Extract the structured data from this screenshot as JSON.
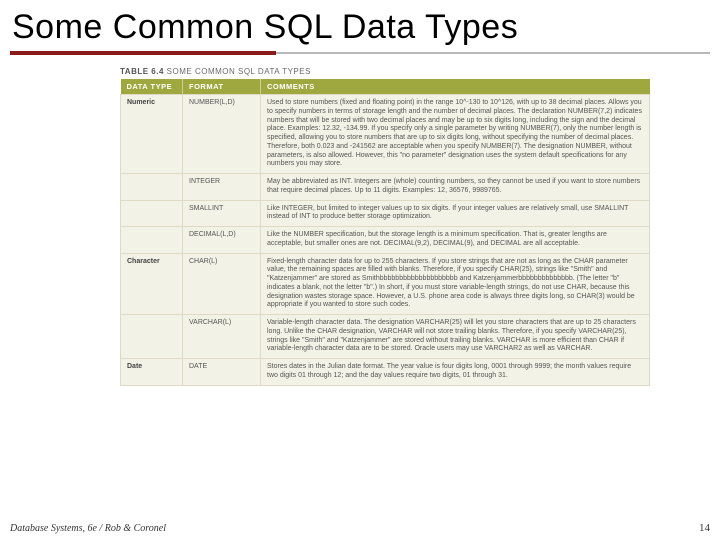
{
  "title": "Some Common SQL Data Types",
  "caption_prefix": "TABLE 6.4",
  "caption_text": "Some Common SQL Data Types",
  "headers": [
    "Data Type",
    "Format",
    "Comments"
  ],
  "rows": [
    {
      "dt": "Numeric",
      "fmt": "NUMBER(L,D)",
      "cmt": "Used to store numbers (fixed and floating point) in the range 10^-130 to 10^126, with up to 38 decimal places. Allows you to specify numbers in terms of storage length and the number of decimal places. The declaration NUMBER(7,2) indicates numbers that will be stored with two decimal places and may be up to six digits long, including the sign and the decimal place. Examples: 12.32, -134.99. If you specify only a single parameter by writing NUMBER(7), only the number length is specified, allowing you to store numbers that are up to six digits long, without specifying the number of decimal places. Therefore, both 0.023 and -241562 are acceptable when you specify NUMBER(7). The designation NUMBER, without parameters, is also allowed. However, this \"no parameter\" designation uses the system default specifications for any numbers you may store."
    },
    {
      "dt": "",
      "fmt": "INTEGER",
      "cmt": "May be abbreviated as INT. Integers are (whole) counting numbers, so they cannot be used if you want to store numbers that require decimal places. Up to 11 digits. Examples: 12, 36576, 9989765."
    },
    {
      "dt": "",
      "fmt": "SMALLINT",
      "cmt": "Like INTEGER, but limited to integer values up to six digits. If your integer values are relatively small, use SMALLINT instead of INT to produce better storage optimization."
    },
    {
      "dt": "",
      "fmt": "DECIMAL(L,D)",
      "cmt": "Like the NUMBER specification, but the storage length is a minimum specification. That is, greater lengths are acceptable, but smaller ones are not. DECIMAL(9,2), DECIMAL(9), and DECIMAL are all acceptable."
    },
    {
      "dt": "Character",
      "fmt": "CHAR(L)",
      "cmt": "Fixed-length character data for up to 255 characters. If you store strings that are not as long as the CHAR parameter value, the remaining spaces are filled with blanks. Therefore, if you specify CHAR(25), strings like \"Smith\" and \"Katzenjammer\" are stored as Smithbbbbbbbbbbbbbbbbbbbb and Katzenjammerbbbbbbbbbbbbbb. (The letter \"b\" indicates a blank, not the letter \"b\".) In short, if you must store variable-length strings, do not use CHAR, because this designation wastes storage space. However, a U.S. phone area code is always three digits long, so CHAR(3) would be appropriate if you wanted to store such codes."
    },
    {
      "dt": "",
      "fmt": "VARCHAR(L)",
      "cmt": "Variable-length character data. The designation VARCHAR(25) will let you store characters that are up to 25 characters long. Unlike the CHAR designation, VARCHAR will not store trailing blanks. Therefore, if you specify VARCHAR(25), strings like \"Smith\" and \"Katzenjammer\" are stored without trailing blanks. VARCHAR is more efficient than CHAR if variable-length character data are to be stored. Oracle users may use VARCHAR2 as well as VARCHAR."
    },
    {
      "dt": "Date",
      "fmt": "DATE",
      "cmt": "Stores dates in the Julian date format. The year value is four digits long, 0001 through 9999; the month values require two digits 01 through 12; and the day values require two digits, 01 through 31."
    }
  ],
  "footer": "Database Systems, 6e / Rob & Coronel",
  "pagenum": "14"
}
